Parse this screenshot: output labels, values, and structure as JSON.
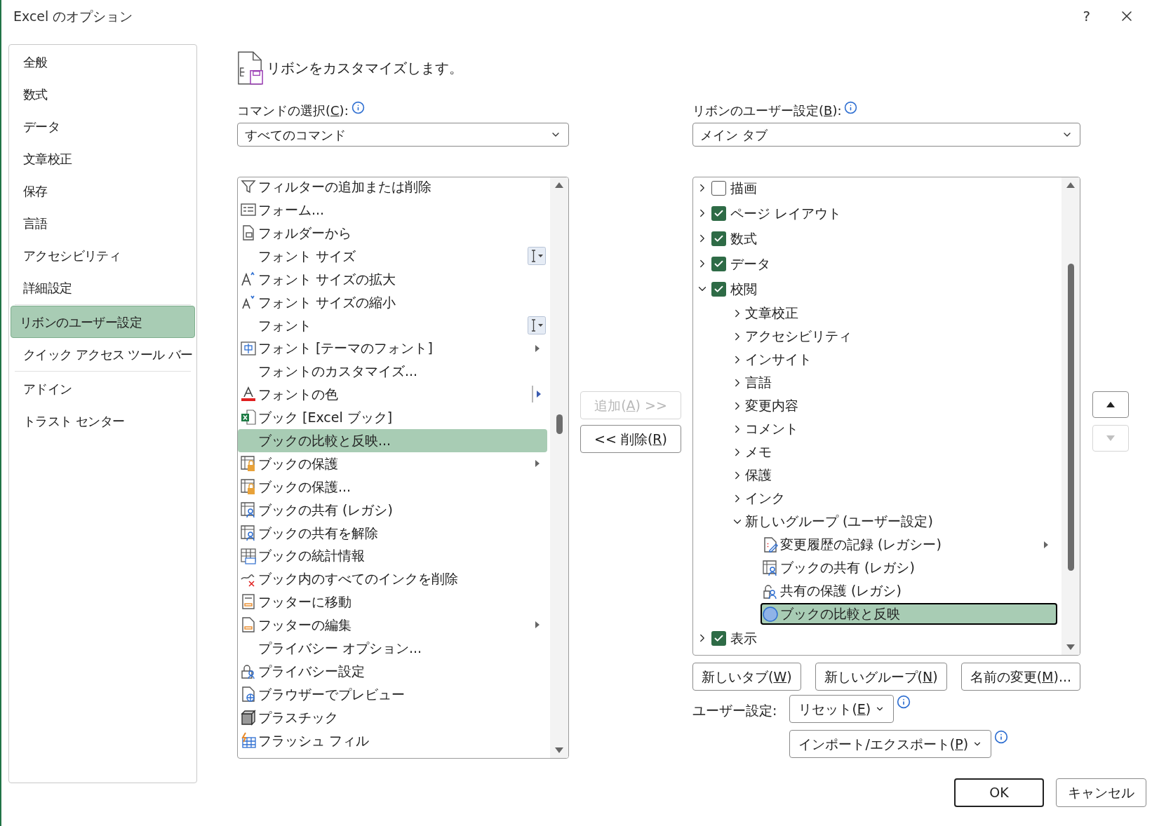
{
  "window": {
    "title": "Excel のオプション",
    "help": "?"
  },
  "sidebar": {
    "groups": [
      [
        {
          "label": "全般",
          "selected": false
        },
        {
          "label": "数式",
          "selected": false
        },
        {
          "label": "データ",
          "selected": false
        },
        {
          "label": "文章校正",
          "selected": false
        },
        {
          "label": "保存",
          "selected": false
        },
        {
          "label": "言語",
          "selected": false
        },
        {
          "label": "アクセシビリティ",
          "selected": false
        },
        {
          "label": "詳細設定",
          "selected": false
        }
      ],
      [
        {
          "label": "リボンのユーザー設定",
          "selected": true
        },
        {
          "label": "クイック アクセス ツール バー",
          "selected": false
        }
      ],
      [
        {
          "label": "アドイン",
          "selected": false
        },
        {
          "label": "トラスト センター",
          "selected": false
        }
      ]
    ]
  },
  "heading": "リボンをカスタマイズします。",
  "commands": {
    "label": [
      "コマンドの選択(",
      "C",
      "):"
    ],
    "value": "すべてのコマンド",
    "rows": [
      {
        "label": "フィルターの追加または削除",
        "kind": "filter",
        "submenu": false,
        "split": false,
        "dropdown": false,
        "selected": false
      },
      {
        "label": "フォーム...",
        "kind": "form",
        "submenu": false,
        "split": false,
        "dropdown": false,
        "selected": false
      },
      {
        "label": "フォルダーから",
        "kind": "folder",
        "submenu": false,
        "split": false,
        "dropdown": false,
        "selected": false
      },
      {
        "label": "フォント サイズ",
        "kind": "none",
        "submenu": false,
        "split": false,
        "dropdown": true,
        "selected": false
      },
      {
        "label": "フォント サイズの拡大",
        "kind": "grow",
        "submenu": false,
        "split": false,
        "dropdown": false,
        "selected": false
      },
      {
        "label": "フォント サイズの縮小",
        "kind": "shrink",
        "submenu": false,
        "split": false,
        "dropdown": false,
        "selected": false
      },
      {
        "label": "フォント",
        "kind": "none",
        "submenu": false,
        "split": false,
        "dropdown": true,
        "selected": false
      },
      {
        "label": "フォント [テーマのフォント]",
        "kind": "theme-font",
        "submenu": true,
        "split": false,
        "dropdown": false,
        "selected": false
      },
      {
        "label": "フォントのカスタマイズ...",
        "kind": "none",
        "submenu": false,
        "split": false,
        "dropdown": false,
        "selected": false
      },
      {
        "label": "フォントの色",
        "kind": "font-color",
        "submenu": false,
        "split": true,
        "dropdown": false,
        "selected": false
      },
      {
        "label": "ブック [Excel ブック]",
        "kind": "excel",
        "submenu": false,
        "split": false,
        "dropdown": false,
        "selected": false
      },
      {
        "label": "ブックの比較と反映...",
        "kind": "none",
        "submenu": false,
        "split": false,
        "dropdown": false,
        "selected": true
      },
      {
        "label": "ブックの保護",
        "kind": "protect",
        "submenu": true,
        "split": false,
        "dropdown": false,
        "selected": false
      },
      {
        "label": "ブックの保護...",
        "kind": "protect",
        "submenu": false,
        "split": false,
        "dropdown": false,
        "selected": false
      },
      {
        "label": "ブックの共有 (レガシ)",
        "kind": "share",
        "submenu": false,
        "split": false,
        "dropdown": false,
        "selected": false
      },
      {
        "label": "ブックの共有を解除",
        "kind": "share",
        "submenu": false,
        "split": false,
        "dropdown": false,
        "selected": false
      },
      {
        "label": "ブックの統計情報",
        "kind": "stats",
        "submenu": false,
        "split": false,
        "dropdown": false,
        "selected": false
      },
      {
        "label": "ブック内のすべてのインクを削除",
        "kind": "ink-delete",
        "submenu": false,
        "split": false,
        "dropdown": false,
        "selected": false
      },
      {
        "label": "フッターに移動",
        "kind": "footer-move",
        "submenu": false,
        "split": false,
        "dropdown": false,
        "selected": false
      },
      {
        "label": "フッターの編集",
        "kind": "footer-edit",
        "submenu": true,
        "split": false,
        "dropdown": false,
        "selected": false
      },
      {
        "label": "プライバシー オプション...",
        "kind": "none",
        "submenu": false,
        "split": false,
        "dropdown": false,
        "selected": false
      },
      {
        "label": "プライバシー設定",
        "kind": "privacy",
        "submenu": false,
        "split": false,
        "dropdown": false,
        "selected": false
      },
      {
        "label": "ブラウザーでプレビュー",
        "kind": "browser",
        "submenu": false,
        "split": false,
        "dropdown": false,
        "selected": false
      },
      {
        "label": "プラスチック",
        "kind": "plastic",
        "submenu": false,
        "split": false,
        "dropdown": false,
        "selected": false
      },
      {
        "label": "フラッシュ フィル",
        "kind": "flash",
        "submenu": false,
        "split": false,
        "dropdown": false,
        "selected": false
      }
    ]
  },
  "add_button": {
    "label": [
      "追加(",
      "A",
      ") >>"
    ],
    "disabled": true
  },
  "remove_button": {
    "label": [
      "<< 削除(",
      "R",
      ")"
    ],
    "disabled": false
  },
  "ribbon": {
    "label": [
      "リボンのユーザー設定(",
      "B",
      "):"
    ],
    "value": "メイン タブ",
    "tree": [
      {
        "label": "描画",
        "checked": false,
        "expanded": false
      },
      {
        "label": "ページ レイアウト",
        "checked": true,
        "expanded": false
      },
      {
        "label": "数式",
        "checked": true,
        "expanded": false
      },
      {
        "label": "データ",
        "checked": true,
        "expanded": false
      },
      {
        "label": "校閲",
        "checked": true,
        "expanded": true,
        "children": [
          {
            "label": "文章校正",
            "expanded": false
          },
          {
            "label": "アクセシビリティ",
            "expanded": false
          },
          {
            "label": "インサイト",
            "expanded": false
          },
          {
            "label": "言語",
            "expanded": false
          },
          {
            "label": "変更内容",
            "expanded": false
          },
          {
            "label": "コメント",
            "expanded": false
          },
          {
            "label": "メモ",
            "expanded": false
          },
          {
            "label": "保護",
            "expanded": false
          },
          {
            "label": "インク",
            "expanded": false
          },
          {
            "label": "新しいグループ (ユーザー設定)",
            "expanded": true,
            "children": [
              {
                "label": "変更履歴の記録 (レガシー)",
                "kind": "track",
                "submenu": true,
                "selected": false
              },
              {
                "label": "ブックの共有 (レガシ)",
                "kind": "share",
                "submenu": false,
                "selected": false
              },
              {
                "label": "共有の保護 (レガシ)",
                "kind": "lock-share",
                "submenu": false,
                "selected": false
              },
              {
                "label": "ブックの比較と反映",
                "kind": "compare",
                "submenu": false,
                "selected": true
              }
            ]
          }
        ]
      },
      {
        "label": "表示",
        "checked": true,
        "expanded": false
      }
    ]
  },
  "tree_buttons": [
    {
      "label": [
        "新しいタブ(",
        "W",
        ")"
      ]
    },
    {
      "label": [
        "新しいグループ(",
        "N",
        ")"
      ]
    },
    {
      "label": [
        "名前の変更(",
        "M",
        ")..."
      ]
    }
  ],
  "customize_label": "ユーザー設定:",
  "reset_button": {
    "label": [
      "リセット(",
      "E",
      ")"
    ]
  },
  "import_button": {
    "label": [
      "インポート/エクスポート(",
      "P",
      ")"
    ]
  },
  "move_up": {
    "disabled": false
  },
  "move_down": {
    "disabled": true
  },
  "ok": "OK",
  "cancel": "キャンセル"
}
